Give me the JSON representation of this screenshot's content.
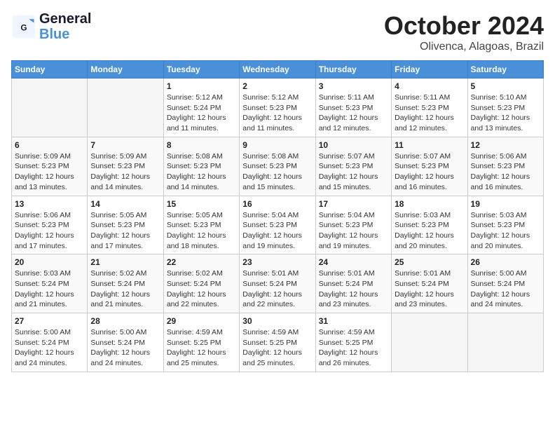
{
  "header": {
    "logo_line1": "General",
    "logo_line2": "Blue",
    "month": "October 2024",
    "location": "Olivenca, Alagoas, Brazil"
  },
  "weekdays": [
    "Sunday",
    "Monday",
    "Tuesday",
    "Wednesday",
    "Thursday",
    "Friday",
    "Saturday"
  ],
  "weeks": [
    [
      {
        "day": "",
        "info": ""
      },
      {
        "day": "",
        "info": ""
      },
      {
        "day": "1",
        "info": "Sunrise: 5:12 AM\nSunset: 5:24 PM\nDaylight: 12 hours\nand 11 minutes."
      },
      {
        "day": "2",
        "info": "Sunrise: 5:12 AM\nSunset: 5:23 PM\nDaylight: 12 hours\nand 11 minutes."
      },
      {
        "day": "3",
        "info": "Sunrise: 5:11 AM\nSunset: 5:23 PM\nDaylight: 12 hours\nand 12 minutes."
      },
      {
        "day": "4",
        "info": "Sunrise: 5:11 AM\nSunset: 5:23 PM\nDaylight: 12 hours\nand 12 minutes."
      },
      {
        "day": "5",
        "info": "Sunrise: 5:10 AM\nSunset: 5:23 PM\nDaylight: 12 hours\nand 13 minutes."
      }
    ],
    [
      {
        "day": "6",
        "info": "Sunrise: 5:09 AM\nSunset: 5:23 PM\nDaylight: 12 hours\nand 13 minutes."
      },
      {
        "day": "7",
        "info": "Sunrise: 5:09 AM\nSunset: 5:23 PM\nDaylight: 12 hours\nand 14 minutes."
      },
      {
        "day": "8",
        "info": "Sunrise: 5:08 AM\nSunset: 5:23 PM\nDaylight: 12 hours\nand 14 minutes."
      },
      {
        "day": "9",
        "info": "Sunrise: 5:08 AM\nSunset: 5:23 PM\nDaylight: 12 hours\nand 15 minutes."
      },
      {
        "day": "10",
        "info": "Sunrise: 5:07 AM\nSunset: 5:23 PM\nDaylight: 12 hours\nand 15 minutes."
      },
      {
        "day": "11",
        "info": "Sunrise: 5:07 AM\nSunset: 5:23 PM\nDaylight: 12 hours\nand 16 minutes."
      },
      {
        "day": "12",
        "info": "Sunrise: 5:06 AM\nSunset: 5:23 PM\nDaylight: 12 hours\nand 16 minutes."
      }
    ],
    [
      {
        "day": "13",
        "info": "Sunrise: 5:06 AM\nSunset: 5:23 PM\nDaylight: 12 hours\nand 17 minutes."
      },
      {
        "day": "14",
        "info": "Sunrise: 5:05 AM\nSunset: 5:23 PM\nDaylight: 12 hours\nand 17 minutes."
      },
      {
        "day": "15",
        "info": "Sunrise: 5:05 AM\nSunset: 5:23 PM\nDaylight: 12 hours\nand 18 minutes."
      },
      {
        "day": "16",
        "info": "Sunrise: 5:04 AM\nSunset: 5:23 PM\nDaylight: 12 hours\nand 19 minutes."
      },
      {
        "day": "17",
        "info": "Sunrise: 5:04 AM\nSunset: 5:23 PM\nDaylight: 12 hours\nand 19 minutes."
      },
      {
        "day": "18",
        "info": "Sunrise: 5:03 AM\nSunset: 5:23 PM\nDaylight: 12 hours\nand 20 minutes."
      },
      {
        "day": "19",
        "info": "Sunrise: 5:03 AM\nSunset: 5:23 PM\nDaylight: 12 hours\nand 20 minutes."
      }
    ],
    [
      {
        "day": "20",
        "info": "Sunrise: 5:03 AM\nSunset: 5:24 PM\nDaylight: 12 hours\nand 21 minutes."
      },
      {
        "day": "21",
        "info": "Sunrise: 5:02 AM\nSunset: 5:24 PM\nDaylight: 12 hours\nand 21 minutes."
      },
      {
        "day": "22",
        "info": "Sunrise: 5:02 AM\nSunset: 5:24 PM\nDaylight: 12 hours\nand 22 minutes."
      },
      {
        "day": "23",
        "info": "Sunrise: 5:01 AM\nSunset: 5:24 PM\nDaylight: 12 hours\nand 22 minutes."
      },
      {
        "day": "24",
        "info": "Sunrise: 5:01 AM\nSunset: 5:24 PM\nDaylight: 12 hours\nand 23 minutes."
      },
      {
        "day": "25",
        "info": "Sunrise: 5:01 AM\nSunset: 5:24 PM\nDaylight: 12 hours\nand 23 minutes."
      },
      {
        "day": "26",
        "info": "Sunrise: 5:00 AM\nSunset: 5:24 PM\nDaylight: 12 hours\nand 24 minutes."
      }
    ],
    [
      {
        "day": "27",
        "info": "Sunrise: 5:00 AM\nSunset: 5:24 PM\nDaylight: 12 hours\nand 24 minutes."
      },
      {
        "day": "28",
        "info": "Sunrise: 5:00 AM\nSunset: 5:24 PM\nDaylight: 12 hours\nand 24 minutes."
      },
      {
        "day": "29",
        "info": "Sunrise: 4:59 AM\nSunset: 5:25 PM\nDaylight: 12 hours\nand 25 minutes."
      },
      {
        "day": "30",
        "info": "Sunrise: 4:59 AM\nSunset: 5:25 PM\nDaylight: 12 hours\nand 25 minutes."
      },
      {
        "day": "31",
        "info": "Sunrise: 4:59 AM\nSunset: 5:25 PM\nDaylight: 12 hours\nand 26 minutes."
      },
      {
        "day": "",
        "info": ""
      },
      {
        "day": "",
        "info": ""
      }
    ]
  ]
}
